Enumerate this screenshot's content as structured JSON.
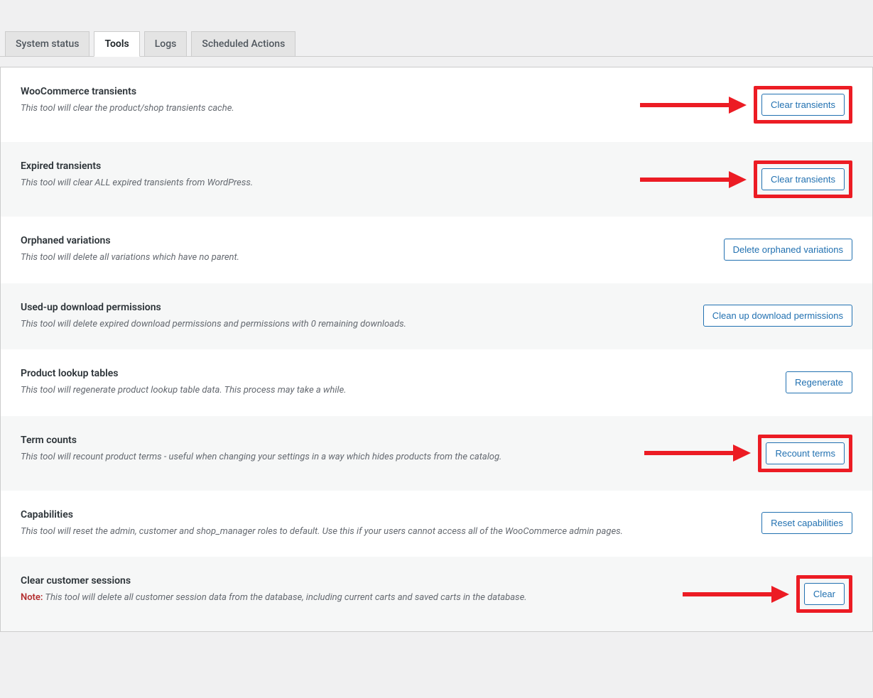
{
  "tabs": [
    {
      "label": "System status",
      "active": false
    },
    {
      "label": "Tools",
      "active": true
    },
    {
      "label": "Logs",
      "active": false
    },
    {
      "label": "Scheduled Actions",
      "active": false
    }
  ],
  "note_prefix": "Note:",
  "tools": [
    {
      "title": "WooCommerce transients",
      "desc": "This tool will clear the product/shop transients cache.",
      "button": "Clear transients",
      "highlighted": true,
      "arrow": true,
      "alt": false
    },
    {
      "title": "Expired transients",
      "desc": "This tool will clear ALL expired transients from WordPress.",
      "button": "Clear transients",
      "highlighted": true,
      "arrow": true,
      "alt": true
    },
    {
      "title": "Orphaned variations",
      "desc": "This tool will delete all variations which have no parent.",
      "button": "Delete orphaned variations",
      "highlighted": false,
      "arrow": false,
      "alt": false
    },
    {
      "title": "Used-up download permissions",
      "desc": "This tool will delete expired download permissions and permissions with 0 remaining downloads.",
      "button": "Clean up download permissions",
      "highlighted": false,
      "arrow": false,
      "alt": true
    },
    {
      "title": "Product lookup tables",
      "desc": "This tool will regenerate product lookup table data. This process may take a while.",
      "button": "Regenerate",
      "highlighted": false,
      "arrow": false,
      "alt": false
    },
    {
      "title": "Term counts",
      "desc": "This tool will recount product terms - useful when changing your settings in a way which hides products from the catalog.",
      "button": "Recount terms",
      "highlighted": true,
      "arrow": true,
      "alt": true
    },
    {
      "title": "Capabilities",
      "desc": "This tool will reset the admin, customer and shop_manager roles to default. Use this if your users cannot access all of the WooCommerce admin pages.",
      "button": "Reset capabilities",
      "highlighted": false,
      "arrow": false,
      "alt": false
    },
    {
      "title": "Clear customer sessions",
      "desc": "This tool will delete all customer session data from the database, including current carts and saved carts in the database.",
      "button": "Clear",
      "highlighted": true,
      "arrow": true,
      "alt": true,
      "note": true
    }
  ],
  "colors": {
    "highlight": "#ec1c24",
    "link": "#2271b1"
  }
}
